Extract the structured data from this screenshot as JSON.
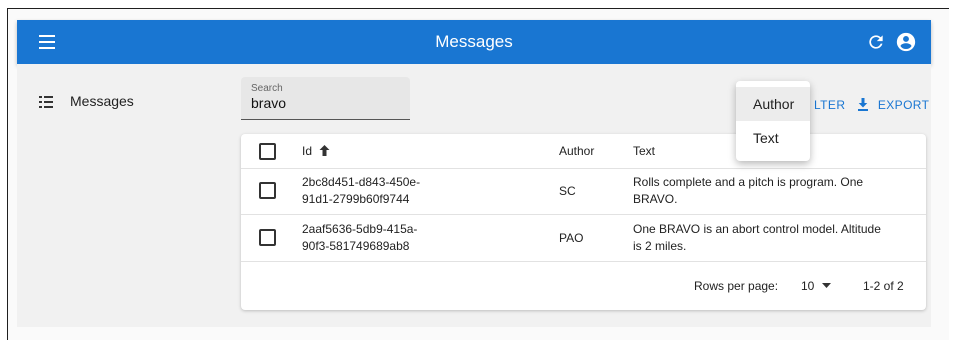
{
  "appbar": {
    "title": "Messages",
    "color": "#1976d2",
    "icons": [
      "menu-icon",
      "refresh-icon",
      "account-circle-icon"
    ]
  },
  "sidebar": {
    "items": [
      {
        "label": "Messages",
        "icon": "list-icon"
      }
    ]
  },
  "search": {
    "label": "Search",
    "value": "bravo"
  },
  "actions": {
    "filter_label": "FILTER",
    "filter_visible_text": "LTER",
    "export_label": "EXPORT"
  },
  "filter_menu": {
    "items": [
      {
        "label": "Author",
        "highlighted": true
      },
      {
        "label": "Text",
        "highlighted": false
      }
    ]
  },
  "table": {
    "headers": {
      "id": "Id",
      "author": "Author",
      "text": "Text"
    },
    "sort": {
      "column": "id",
      "direction": "ascending"
    },
    "rows": [
      {
        "id_line1": "2bc8d451-d843-450e-",
        "id_line2": "91d1-2799b60f9744",
        "author": "SC",
        "text_line1": "Rolls complete and a pitch is program. One",
        "text_line2": "BRAVO."
      },
      {
        "id_line1": "2aaf5636-5db9-415a-",
        "id_line2": "90f3-581749689ab8",
        "author": "PAO",
        "text_line1": "One BRAVO is an abort control model. Altitude",
        "text_line2": "is 2 miles."
      }
    ],
    "pagination": {
      "rows_per_page_label": "Rows per page:",
      "rows_per_page_value": "10",
      "range": "1-2 of 2"
    }
  }
}
